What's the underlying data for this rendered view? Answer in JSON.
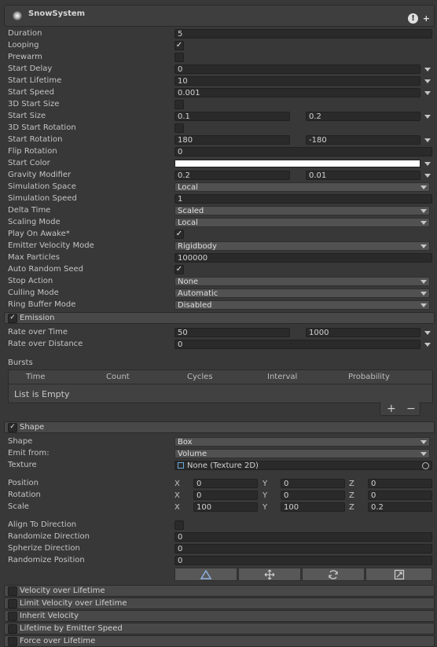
{
  "header": {
    "title": "SnowSystem",
    "warn_glyph": "!",
    "add_glyph": "+"
  },
  "main": {
    "duration": {
      "label": "Duration",
      "value": "5"
    },
    "looping": {
      "label": "Looping",
      "checked": "✓"
    },
    "prewarm": {
      "label": "Prewarm"
    },
    "start_delay": {
      "label": "Start Delay",
      "value": "0"
    },
    "start_lifetime": {
      "label": "Start Lifetime",
      "value": "10"
    },
    "start_speed": {
      "label": "Start Speed",
      "value": "0.001"
    },
    "start_size_3d": {
      "label": "3D Start Size"
    },
    "start_size": {
      "label": "Start Size",
      "min": "0.1",
      "max": "0.2"
    },
    "start_rotation_3d": {
      "label": "3D Start Rotation"
    },
    "start_rotation": {
      "label": "Start Rotation",
      "min": "180",
      "max": "-180"
    },
    "flip_rotation": {
      "label": "Flip Rotation",
      "value": "0"
    },
    "start_color": {
      "label": "Start Color",
      "color": "#ffffff"
    },
    "gravity_modifier": {
      "label": "Gravity Modifier",
      "min": "0.2",
      "max": "0.01"
    },
    "simulation_space": {
      "label": "Simulation Space",
      "value": "Local"
    },
    "simulation_speed": {
      "label": "Simulation Speed",
      "value": "1"
    },
    "delta_time": {
      "label": "Delta Time",
      "value": "Scaled"
    },
    "scaling_mode": {
      "label": "Scaling Mode",
      "value": "Local"
    },
    "play_on_awake": {
      "label": "Play On Awake*",
      "checked": "✓"
    },
    "emitter_velocity_mode": {
      "label": "Emitter Velocity Mode",
      "value": "Rigidbody"
    },
    "max_particles": {
      "label": "Max Particles",
      "value": "100000"
    },
    "auto_random_seed": {
      "label": "Auto Random Seed",
      "checked": "✓"
    },
    "stop_action": {
      "label": "Stop Action",
      "value": "None"
    },
    "culling_mode": {
      "label": "Culling Mode",
      "value": "Automatic"
    },
    "ring_buffer_mode": {
      "label": "Ring Buffer Mode",
      "value": "Disabled"
    }
  },
  "emission": {
    "title": "Emission",
    "checked": "✓",
    "rate_over_time": {
      "label": "Rate over Time",
      "min": "50",
      "max": "1000"
    },
    "rate_over_distance": {
      "label": "Rate over Distance",
      "value": "0"
    },
    "bursts": {
      "label": "Bursts",
      "columns": [
        "Time",
        "Count",
        "Cycles",
        "Interval",
        "Probability"
      ],
      "empty_text": "List is Empty",
      "add": "+",
      "remove": "−"
    }
  },
  "shape": {
    "title": "Shape",
    "checked": "✓",
    "shape": {
      "label": "Shape",
      "value": "Box"
    },
    "emit_from": {
      "label": "Emit from:",
      "value": "Volume"
    },
    "texture": {
      "label": "Texture",
      "value": "None (Texture 2D)"
    },
    "axis": {
      "x": "X",
      "y": "Y",
      "z": "Z"
    },
    "position": {
      "label": "Position",
      "x": "0",
      "y": "0",
      "z": "0"
    },
    "rotation": {
      "label": "Rotation",
      "x": "0",
      "y": "0",
      "z": "0"
    },
    "scale": {
      "label": "Scale",
      "x": "100",
      "y": "100",
      "z": "0.2"
    },
    "align_to_direction": {
      "label": "Align To Direction"
    },
    "randomize_direction": {
      "label": "Randomize Direction",
      "value": "0"
    },
    "spherize_direction": {
      "label": "Spherize Direction",
      "value": "0"
    },
    "randomize_position": {
      "label": "Randomize Position",
      "value": "0"
    },
    "tool_icons": [
      "edit-shape-icon",
      "move-icon",
      "rotate-icon",
      "scale-icon"
    ]
  },
  "modules": [
    {
      "label": "Velocity over Lifetime"
    },
    {
      "label": "Limit Velocity over Lifetime"
    },
    {
      "label": "Inherit Velocity"
    },
    {
      "label": "Lifetime by Emitter Speed"
    },
    {
      "label": "Force over Lifetime"
    }
  ]
}
